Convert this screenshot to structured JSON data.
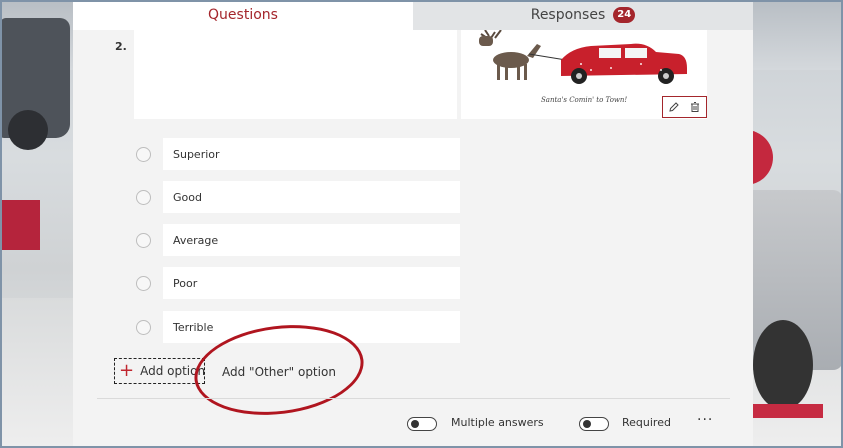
{
  "tabs": {
    "questions": "Questions",
    "responses": "Responses",
    "responses_count": "24"
  },
  "question": {
    "number": "2.",
    "image_caption": "Santa's Comin' to Town!"
  },
  "options": [
    "Superior",
    "Good",
    "Average",
    "Poor",
    "Terrible"
  ],
  "actions": {
    "add_option": "Add option",
    "add_other": "Add \"Other\" option"
  },
  "footer": {
    "multiple_answers": "Multiple answers",
    "required": "Required",
    "more": "···"
  },
  "colors": {
    "accent": "#a4262c",
    "annotation": "#b0151f"
  }
}
